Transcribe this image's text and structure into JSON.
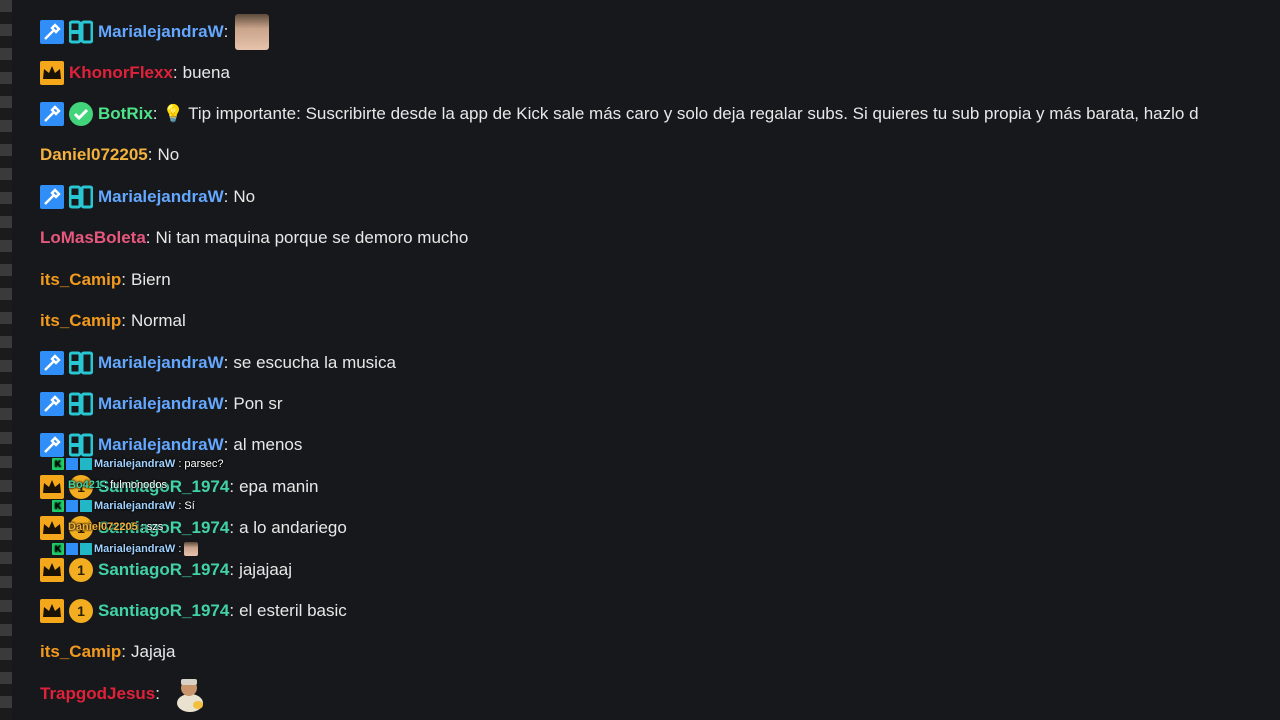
{
  "chat": {
    "messages": [
      {
        "user": "MarialejandraW",
        "sep": ":",
        "text": ""
      },
      {
        "user": "KhonorFlexx",
        "sep": ":",
        "text": "buena"
      },
      {
        "user": "BotRix",
        "sep": ":",
        "text": "💡  Tip importante: Suscribirte desde la app de Kick sale más caro y solo deja regalar subs. Si quieres tu sub propia y más barata, hazlo d"
      },
      {
        "user": "Daniel072205",
        "sep": ":",
        "text": "No"
      },
      {
        "user": "MarialejandraW",
        "sep": ":",
        "text": "No"
      },
      {
        "user": "LoMasBoleta",
        "sep": ":",
        "text": "Ni tan maquina porque se demoro mucho"
      },
      {
        "user": "its_Camip",
        "sep": ":",
        "text": "Biern"
      },
      {
        "user": "its_Camip",
        "sep": ":",
        "text": "Normal"
      },
      {
        "user": "MarialejandraW",
        "sep": ":",
        "text": "se escucha la musica"
      },
      {
        "user": "MarialejandraW",
        "sep": ":",
        "text": "Pon sr"
      },
      {
        "user": "MarialejandraW",
        "sep": ":",
        "text": "al menos"
      },
      {
        "user": "SantiagoR_1974",
        "sep": ":",
        "text": "epa manin"
      },
      {
        "user": "SantiagoR_1974",
        "sep": ":",
        "text": "a lo andariego"
      },
      {
        "user": "SantiagoR_1974",
        "sep": ":",
        "text": "jajajaaj"
      },
      {
        "user": "SantiagoR_1974",
        "sep": ":",
        "text": "el esteril basic"
      },
      {
        "user": "its_Camip",
        "sep": ":",
        "text": "Jajaja"
      },
      {
        "user": "TrapgodJesus",
        "sep": ":",
        "text": ""
      }
    ],
    "coin_badge": "1"
  },
  "overlay": {
    "lines": [
      {
        "user": "MarialejandraW",
        "sep": ":",
        "text": "parsec?"
      },
      {
        "user": "Bo421",
        "sep": ":",
        "text": "fulmonodos"
      },
      {
        "user": "MarialejandraW",
        "sep": ":",
        "text": "Sí"
      },
      {
        "user": "Daniel072205",
        "sep": ":",
        "text": "szs"
      },
      {
        "user": "MarialejandraW",
        "sep": ":",
        "text": ""
      }
    ],
    "k_label": "K"
  },
  "colors": {
    "background": "#17181b",
    "mod_badge": "#2f8ef7",
    "crown_badge": "#f4a71a",
    "marialejandra": "#64a7ff",
    "khonor": "#e0213a",
    "botrix": "#4ee38a",
    "daniel": "#f3b13e",
    "lomasboleta": "#e8577e",
    "camip": "#f29a1d",
    "santiago": "#41d3a5",
    "trapgod": "#e0213a"
  }
}
